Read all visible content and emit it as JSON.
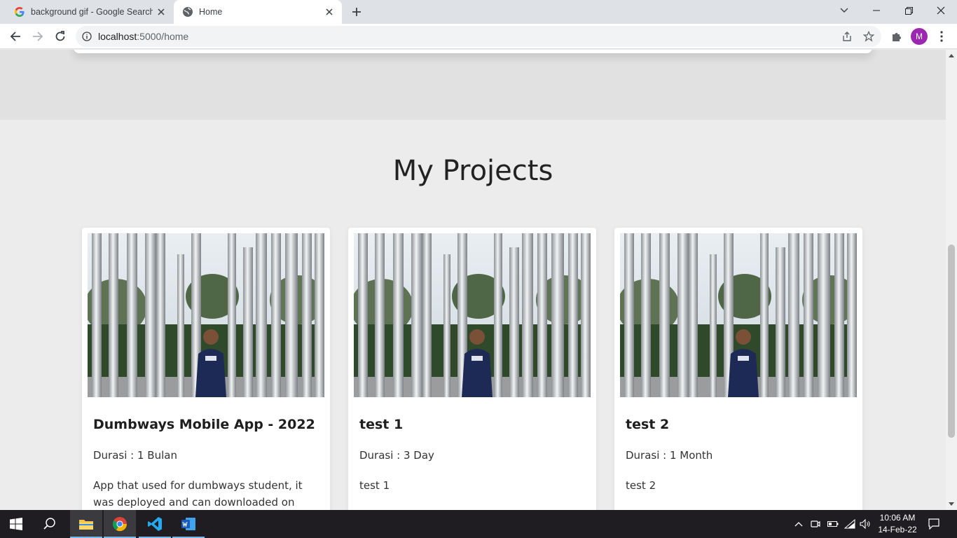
{
  "browser": {
    "tabs": [
      {
        "title": "background gif - Google Search",
        "active": false
      },
      {
        "title": "Home",
        "active": true
      }
    ],
    "url_host": "localhost",
    "url_path": ":5000/home",
    "profile_initial": "M"
  },
  "page": {
    "section_title": "My Projects",
    "projects": [
      {
        "title": "Dumbways Mobile App - 2022",
        "duration": "Durasi : 1 Bulan",
        "description": "App that used for dumbways student, it was deployed and can downloaded on playstore."
      },
      {
        "title": "test 1",
        "duration": "Durasi : 3 Day",
        "description": "test 1"
      },
      {
        "title": "test 2",
        "duration": "Durasi : 1 Month",
        "description": "test 2"
      }
    ]
  },
  "taskbar": {
    "apps": [
      "start-icon",
      "search-icon",
      "file-explorer-icon",
      "chrome-icon",
      "vscode-icon",
      "word-icon"
    ],
    "time": "10:06 AM",
    "date": "14-Feb-22"
  },
  "colors": {
    "accent_profile": "#9c27b0",
    "taskbar_bg": "#1f1d21",
    "page_bg": "#ececec"
  }
}
